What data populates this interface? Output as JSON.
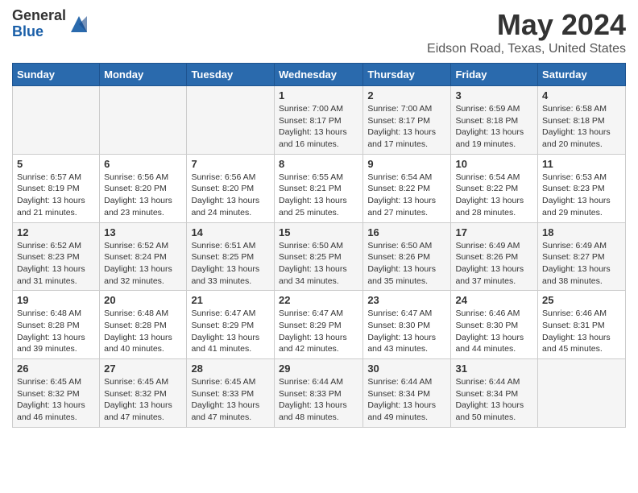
{
  "logo": {
    "general": "General",
    "blue": "Blue"
  },
  "header": {
    "title": "May 2024",
    "subtitle": "Eidson Road, Texas, United States"
  },
  "weekdays": [
    "Sunday",
    "Monday",
    "Tuesday",
    "Wednesday",
    "Thursday",
    "Friday",
    "Saturday"
  ],
  "weeks": [
    [
      {
        "day": "",
        "info": ""
      },
      {
        "day": "",
        "info": ""
      },
      {
        "day": "",
        "info": ""
      },
      {
        "day": "1",
        "info": "Sunrise: 7:00 AM\nSunset: 8:17 PM\nDaylight: 13 hours\nand 16 minutes."
      },
      {
        "day": "2",
        "info": "Sunrise: 7:00 AM\nSunset: 8:17 PM\nDaylight: 13 hours\nand 17 minutes."
      },
      {
        "day": "3",
        "info": "Sunrise: 6:59 AM\nSunset: 8:18 PM\nDaylight: 13 hours\nand 19 minutes."
      },
      {
        "day": "4",
        "info": "Sunrise: 6:58 AM\nSunset: 8:18 PM\nDaylight: 13 hours\nand 20 minutes."
      }
    ],
    [
      {
        "day": "5",
        "info": "Sunrise: 6:57 AM\nSunset: 8:19 PM\nDaylight: 13 hours\nand 21 minutes."
      },
      {
        "day": "6",
        "info": "Sunrise: 6:56 AM\nSunset: 8:20 PM\nDaylight: 13 hours\nand 23 minutes."
      },
      {
        "day": "7",
        "info": "Sunrise: 6:56 AM\nSunset: 8:20 PM\nDaylight: 13 hours\nand 24 minutes."
      },
      {
        "day": "8",
        "info": "Sunrise: 6:55 AM\nSunset: 8:21 PM\nDaylight: 13 hours\nand 25 minutes."
      },
      {
        "day": "9",
        "info": "Sunrise: 6:54 AM\nSunset: 8:22 PM\nDaylight: 13 hours\nand 27 minutes."
      },
      {
        "day": "10",
        "info": "Sunrise: 6:54 AM\nSunset: 8:22 PM\nDaylight: 13 hours\nand 28 minutes."
      },
      {
        "day": "11",
        "info": "Sunrise: 6:53 AM\nSunset: 8:23 PM\nDaylight: 13 hours\nand 29 minutes."
      }
    ],
    [
      {
        "day": "12",
        "info": "Sunrise: 6:52 AM\nSunset: 8:23 PM\nDaylight: 13 hours\nand 31 minutes."
      },
      {
        "day": "13",
        "info": "Sunrise: 6:52 AM\nSunset: 8:24 PM\nDaylight: 13 hours\nand 32 minutes."
      },
      {
        "day": "14",
        "info": "Sunrise: 6:51 AM\nSunset: 8:25 PM\nDaylight: 13 hours\nand 33 minutes."
      },
      {
        "day": "15",
        "info": "Sunrise: 6:50 AM\nSunset: 8:25 PM\nDaylight: 13 hours\nand 34 minutes."
      },
      {
        "day": "16",
        "info": "Sunrise: 6:50 AM\nSunset: 8:26 PM\nDaylight: 13 hours\nand 35 minutes."
      },
      {
        "day": "17",
        "info": "Sunrise: 6:49 AM\nSunset: 8:26 PM\nDaylight: 13 hours\nand 37 minutes."
      },
      {
        "day": "18",
        "info": "Sunrise: 6:49 AM\nSunset: 8:27 PM\nDaylight: 13 hours\nand 38 minutes."
      }
    ],
    [
      {
        "day": "19",
        "info": "Sunrise: 6:48 AM\nSunset: 8:28 PM\nDaylight: 13 hours\nand 39 minutes."
      },
      {
        "day": "20",
        "info": "Sunrise: 6:48 AM\nSunset: 8:28 PM\nDaylight: 13 hours\nand 40 minutes."
      },
      {
        "day": "21",
        "info": "Sunrise: 6:47 AM\nSunset: 8:29 PM\nDaylight: 13 hours\nand 41 minutes."
      },
      {
        "day": "22",
        "info": "Sunrise: 6:47 AM\nSunset: 8:29 PM\nDaylight: 13 hours\nand 42 minutes."
      },
      {
        "day": "23",
        "info": "Sunrise: 6:47 AM\nSunset: 8:30 PM\nDaylight: 13 hours\nand 43 minutes."
      },
      {
        "day": "24",
        "info": "Sunrise: 6:46 AM\nSunset: 8:30 PM\nDaylight: 13 hours\nand 44 minutes."
      },
      {
        "day": "25",
        "info": "Sunrise: 6:46 AM\nSunset: 8:31 PM\nDaylight: 13 hours\nand 45 minutes."
      }
    ],
    [
      {
        "day": "26",
        "info": "Sunrise: 6:45 AM\nSunset: 8:32 PM\nDaylight: 13 hours\nand 46 minutes."
      },
      {
        "day": "27",
        "info": "Sunrise: 6:45 AM\nSunset: 8:32 PM\nDaylight: 13 hours\nand 47 minutes."
      },
      {
        "day": "28",
        "info": "Sunrise: 6:45 AM\nSunset: 8:33 PM\nDaylight: 13 hours\nand 47 minutes."
      },
      {
        "day": "29",
        "info": "Sunrise: 6:44 AM\nSunset: 8:33 PM\nDaylight: 13 hours\nand 48 minutes."
      },
      {
        "day": "30",
        "info": "Sunrise: 6:44 AM\nSunset: 8:34 PM\nDaylight: 13 hours\nand 49 minutes."
      },
      {
        "day": "31",
        "info": "Sunrise: 6:44 AM\nSunset: 8:34 PM\nDaylight: 13 hours\nand 50 minutes."
      },
      {
        "day": "",
        "info": ""
      }
    ]
  ]
}
